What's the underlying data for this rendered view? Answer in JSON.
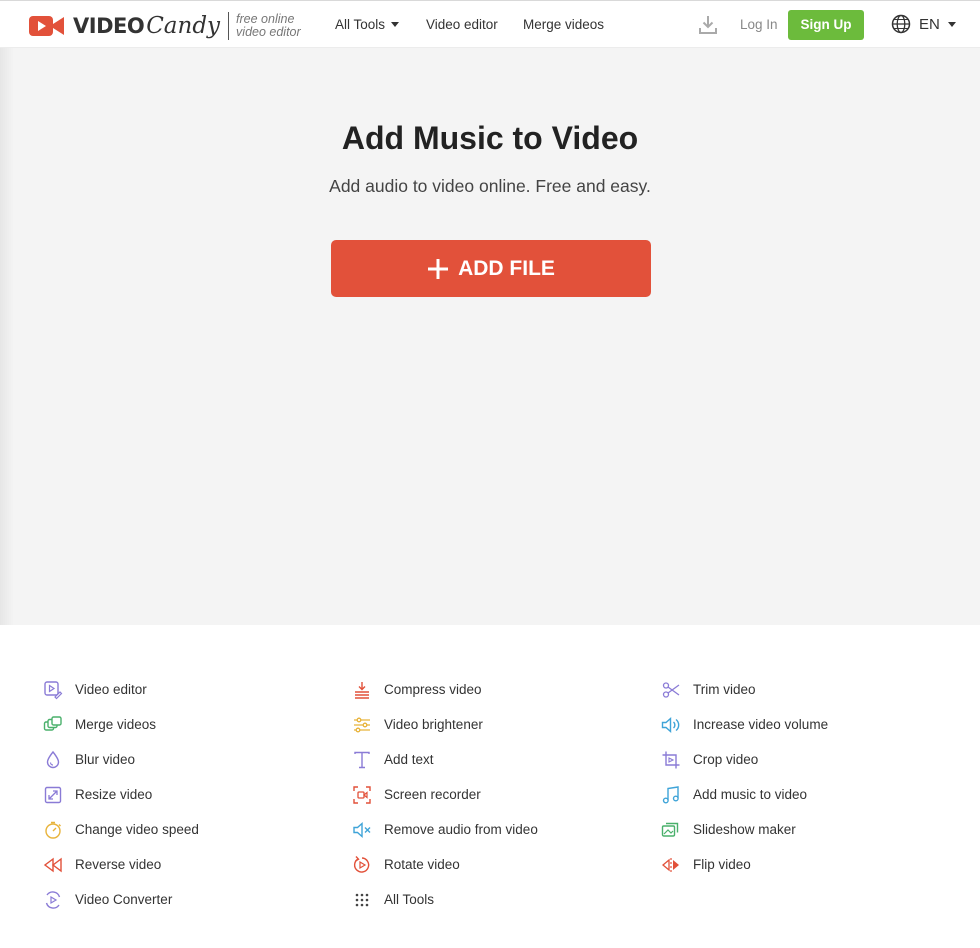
{
  "header": {
    "logo_word": "VIDEO",
    "logo_candy": "Candy",
    "logo_tag_line1": "free online",
    "logo_tag_line2": "video editor",
    "nav": [
      {
        "label": "All Tools",
        "has_caret": true
      },
      {
        "label": "Video editor"
      },
      {
        "label": "Merge videos"
      }
    ],
    "login_label": "Log In",
    "signup_label": "Sign Up",
    "language": "EN"
  },
  "hero": {
    "title": "Add Music to Video",
    "subtitle": "Add audio to video online. Free and easy.",
    "add_button_label": "ADD FILE",
    "add_button_icon": "plus"
  },
  "colors": {
    "brand_red": "#e2513a",
    "signup_green": "#6cbb3c",
    "hero_bg": "#f4f4f4"
  },
  "tools": {
    "col1": [
      {
        "label": "Video editor",
        "icon": "video-edit-icon"
      },
      {
        "label": "Merge videos",
        "icon": "merge-icon"
      },
      {
        "label": "Blur video",
        "icon": "blur-drop-icon"
      },
      {
        "label": "Resize video",
        "icon": "resize-icon"
      },
      {
        "label": "Change video speed",
        "icon": "speed-icon"
      },
      {
        "label": "Reverse video",
        "icon": "reverse-icon"
      },
      {
        "label": "Video Converter",
        "icon": "convert-icon"
      }
    ],
    "col2": [
      {
        "label": "Compress video",
        "icon": "compress-icon"
      },
      {
        "label": "Video brightener",
        "icon": "sliders-icon"
      },
      {
        "label": "Add text",
        "icon": "text-icon"
      },
      {
        "label": "Screen recorder",
        "icon": "screen-record-icon"
      },
      {
        "label": "Remove audio from video",
        "icon": "mute-icon"
      },
      {
        "label": "Rotate video",
        "icon": "rotate-icon"
      },
      {
        "label": "All Tools",
        "icon": "grid-icon"
      }
    ],
    "col3": [
      {
        "label": "Trim video",
        "icon": "scissors-icon"
      },
      {
        "label": "Increase video volume",
        "icon": "volume-icon"
      },
      {
        "label": "Crop video",
        "icon": "crop-icon"
      },
      {
        "label": "Add music to video",
        "icon": "music-icon"
      },
      {
        "label": "Slideshow maker",
        "icon": "slideshow-icon"
      },
      {
        "label": "Flip video",
        "icon": "flip-icon"
      }
    ]
  }
}
